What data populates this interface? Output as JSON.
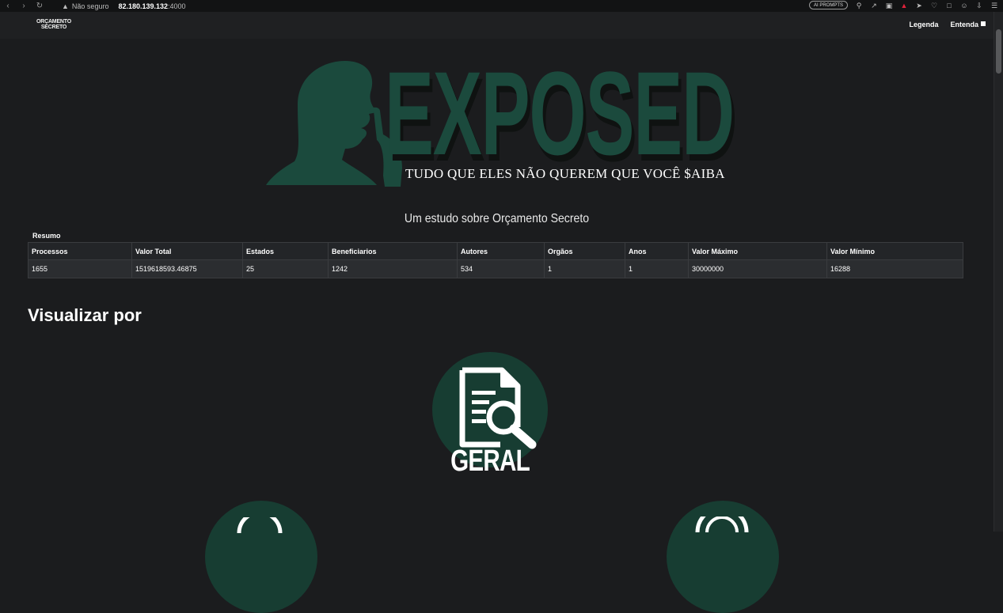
{
  "browser": {
    "security_text": "Não seguro",
    "url_host": "82.180.139.132",
    "url_port": ":4000",
    "ai_prompts": "AI PROMPTS"
  },
  "navbar": {
    "logo_line1": "ORÇAMENTO",
    "logo_line2": "SECRETO",
    "links": [
      "Legenda",
      "Entenda"
    ]
  },
  "hero": {
    "title": "EXPOSED",
    "subtitle": "TUDO QUE ELES NÃO QUEREM QUE VOCÊ $AIBA"
  },
  "study_title": "Um estudo sobre Orçamento Secreto",
  "summary": {
    "label": "Resumo",
    "headers": [
      "Processos",
      "Valor Total",
      "Estados",
      "Beneficiarios",
      "Autores",
      "Orgãos",
      "Anos",
      "Valor Máximo",
      "Valor Mínimo"
    ],
    "row": [
      "1655",
      "1519618593.46875",
      "25",
      "1242",
      "534",
      "1",
      "1",
      "30000000",
      "16288"
    ]
  },
  "visualizar_title": "Visualizar por",
  "cards": {
    "geral_label": "GERAL"
  },
  "colors": {
    "accent": "#1b4a3d",
    "circle": "#173d32",
    "background": "#1b1c1e"
  }
}
